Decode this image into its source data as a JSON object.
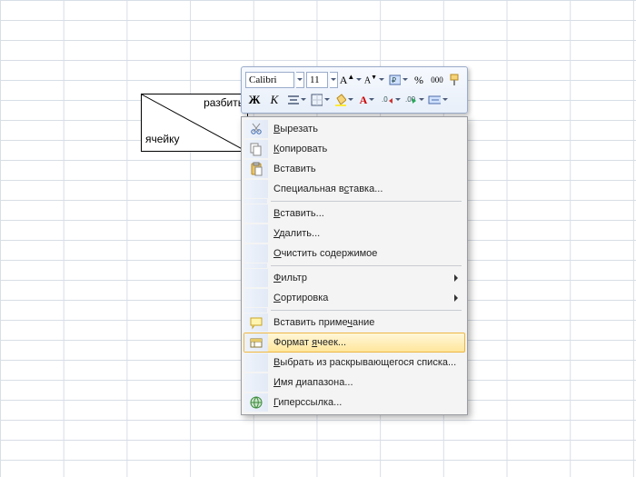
{
  "cell": {
    "top_text": "разбить",
    "bottom_text": "ячейку"
  },
  "mini_toolbar": {
    "font_name": "Calibri",
    "font_size": "11",
    "percent_label": "%",
    "thousands_label": "000"
  },
  "context_menu": {
    "cut": "Вырезать",
    "copy": "Копировать",
    "paste": "Вставить",
    "paste_special": "Специальная вставка...",
    "insert": "Вставить...",
    "delete": "Удалить...",
    "clear": "Очистить содержимое",
    "filter": "Фильтр",
    "sort": "Сортировка",
    "insert_comment": "Вставить примечание",
    "format_cells": "Формат ячеек...",
    "pick_from_list": "Выбрать из раскрывающегося списка...",
    "name_range": "Имя диапазона...",
    "hyperlink": "Гиперссылка..."
  },
  "inline_underline_letters": {
    "cut": "В",
    "copy": "К",
    "paste_special": "с",
    "insert": "В",
    "delete": "У",
    "clear": "О",
    "filter": "Ф",
    "sort": "С",
    "insert_comment": "ч",
    "format_cells": "я",
    "pick_from_list": "В",
    "name_range": "И",
    "hyperlink": "Г"
  }
}
